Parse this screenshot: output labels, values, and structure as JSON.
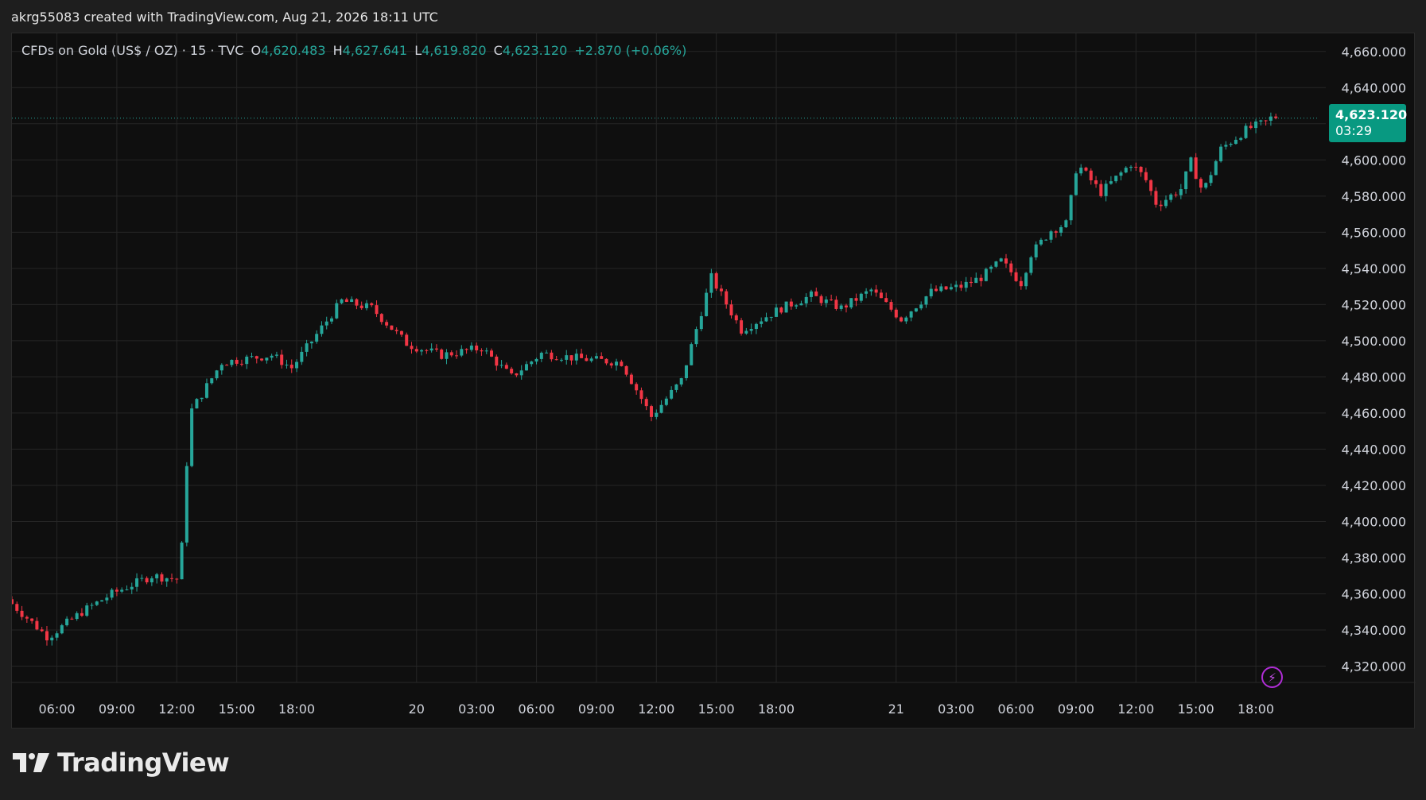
{
  "header": {
    "credit": "akrg55083 created with TradingView.com, Aug 21, 2026 18:11 UTC"
  },
  "legend": {
    "symbol": "CFDs on Gold (US$ / OZ) · 15 · TVC",
    "o_label": "O",
    "o_value": "4,620.483",
    "h_label": "H",
    "h_value": "4,627.641",
    "l_label": "L",
    "l_value": "4,619.820",
    "c_label": "C",
    "c_value": "4,623.120",
    "change": "+2.870 (+0.06%)"
  },
  "last_price": {
    "value": "4,623.120",
    "countdown": "03:29"
  },
  "brand": {
    "name": "TradingView"
  },
  "icons": {
    "alert": "lightning-icon",
    "logo": "tradingview-logo-icon"
  },
  "colors": {
    "up": "#26a69a",
    "down": "#f23645",
    "background": "#0f0f0f",
    "grid": "#262626",
    "badge": "#089981"
  },
  "chart_data": {
    "type": "candlestick",
    "interval": "15",
    "y_ticks": [
      "4,320.000",
      "4,340.000",
      "4,360.000",
      "4,380.000",
      "4,400.000",
      "4,420.000",
      "4,440.000",
      "4,460.000",
      "4,480.000",
      "4,500.000",
      "4,520.000",
      "4,540.000",
      "4,560.000",
      "4,580.000",
      "4,600.000",
      "4,620.000",
      "4,640.000",
      "4,660.000"
    ],
    "y_tick_values": [
      4320,
      4340,
      4360,
      4380,
      4400,
      4420,
      4440,
      4460,
      4480,
      4500,
      4520,
      4540,
      4560,
      4580,
      4600,
      4620,
      4640,
      4660
    ],
    "ylim": [
      4311,
      4670
    ],
    "x_ticks": [
      "06:00",
      "09:00",
      "12:00",
      "15:00",
      "18:00",
      "20",
      "03:00",
      "06:00",
      "09:00",
      "12:00",
      "15:00",
      "18:00",
      "21",
      "03:00",
      "06:00",
      "09:00",
      "12:00",
      "15:00",
      "18:00"
    ],
    "x_tick_hours": [
      6,
      9,
      12,
      15,
      18,
      24,
      27,
      30,
      33,
      36,
      39,
      42,
      48,
      51,
      54,
      57,
      60,
      63,
      66
    ],
    "xlim_hours": [
      3.75,
      69.5
    ],
    "keypoints": [
      {
        "t": 3.75,
        "p": 4357
      },
      {
        "t": 5.8,
        "p": 4336
      },
      {
        "t": 7.5,
        "p": 4350
      },
      {
        "t": 9.0,
        "p": 4360
      },
      {
        "t": 11.0,
        "p": 4370
      },
      {
        "t": 12.4,
        "p": 4368
      },
      {
        "t": 12.9,
        "p": 4460
      },
      {
        "t": 14.5,
        "p": 4488
      },
      {
        "t": 17.0,
        "p": 4492
      },
      {
        "t": 18.0,
        "p": 4485
      },
      {
        "t": 20.5,
        "p": 4522
      },
      {
        "t": 22.0,
        "p": 4518
      },
      {
        "t": 23.8,
        "p": 4498
      },
      {
        "t": 25.5,
        "p": 4492
      },
      {
        "t": 27.5,
        "p": 4496
      },
      {
        "t": 29.0,
        "p": 4480
      },
      {
        "t": 30.5,
        "p": 4493
      },
      {
        "t": 32.5,
        "p": 4490
      },
      {
        "t": 34.5,
        "p": 4488
      },
      {
        "t": 36.0,
        "p": 4458
      },
      {
        "t": 37.5,
        "p": 4478
      },
      {
        "t": 39.0,
        "p": 4535
      },
      {
        "t": 40.5,
        "p": 4506
      },
      {
        "t": 42.5,
        "p": 4518
      },
      {
        "t": 44.0,
        "p": 4525
      },
      {
        "t": 45.5,
        "p": 4518
      },
      {
        "t": 47.0,
        "p": 4528
      },
      {
        "t": 48.5,
        "p": 4512
      },
      {
        "t": 50.0,
        "p": 4527
      },
      {
        "t": 51.5,
        "p": 4530
      },
      {
        "t": 52.5,
        "p": 4535
      },
      {
        "t": 53.5,
        "p": 4544
      },
      {
        "t": 54.5,
        "p": 4532
      },
      {
        "t": 55.0,
        "p": 4548
      },
      {
        "t": 56.0,
        "p": 4561
      },
      {
        "t": 56.8,
        "p": 4565
      },
      {
        "t": 57.3,
        "p": 4598
      },
      {
        "t": 58.5,
        "p": 4582
      },
      {
        "t": 60.0,
        "p": 4598
      },
      {
        "t": 60.7,
        "p": 4590
      },
      {
        "t": 61.3,
        "p": 4575
      },
      {
        "t": 62.5,
        "p": 4584
      },
      {
        "t": 63.0,
        "p": 4599
      },
      {
        "t": 63.6,
        "p": 4582
      },
      {
        "t": 64.5,
        "p": 4606
      },
      {
        "t": 65.8,
        "p": 4617
      },
      {
        "t": 66.8,
        "p": 4621
      },
      {
        "t": 67.0,
        "p": 4623.12
      }
    ]
  }
}
